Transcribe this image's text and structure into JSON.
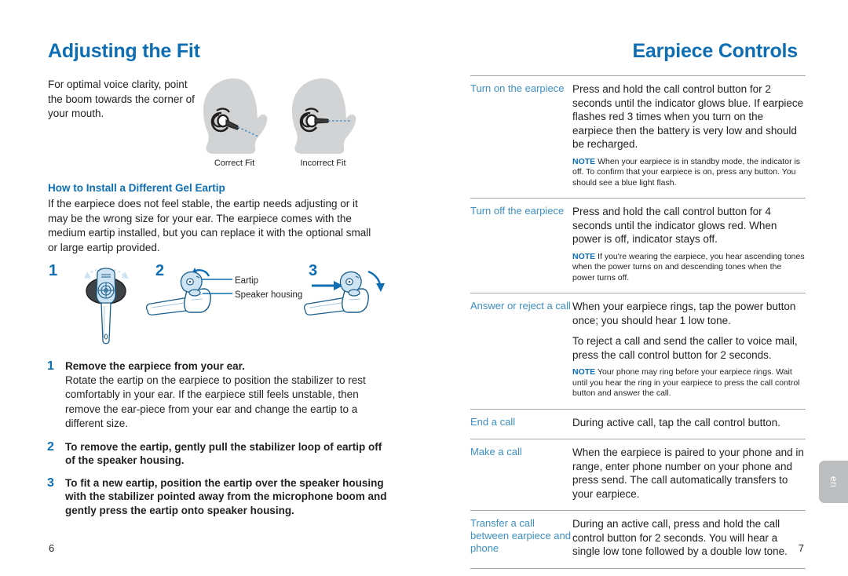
{
  "document": {
    "language_tab": "en"
  },
  "left_page": {
    "title": "Adjusting the Fit",
    "folio": "6",
    "intro": "For optimal voice clarity, point the boom towards the corner of your mouth.",
    "figures": [
      {
        "caption": "Correct Fit",
        "icon": "head-with-earpiece-correct-icon"
      },
      {
        "caption": "Incorrect Fit",
        "icon": "head-with-earpiece-incorrect-icon"
      }
    ],
    "subhead": "How to Install a Different Gel Eartip",
    "paragraph": "If the earpiece does not feel stable, the eartip needs adjusting or it may be the wrong size for your ear. The earpiece comes with the medium eartip installed, but you can replace it with the optional small or large eartip provided.",
    "figure_steps": [
      {
        "number": "1"
      },
      {
        "number": "2"
      },
      {
        "number": "3"
      }
    ],
    "figure_callouts": [
      "Eartip",
      "Speaker housing"
    ],
    "instructions": [
      {
        "number": "1",
        "lead": "Remove the earpiece from your ear.",
        "detail": "Rotate the eartip on the earpiece to position the stabilizer to rest comfortably in your ear. If the earpiece still feels unstable, then remove the ear-piece from your ear and change the eartip to a different size."
      },
      {
        "number": "2",
        "lead": "To remove the eartip, gently pull the stabilizer loop of eartip off of the speaker housing.",
        "detail": ""
      },
      {
        "number": "3",
        "lead": "To fit a new eartip, position the eartip over the speaker housing with the stabilizer pointed away from the microphone boom and gently press the eartip onto speaker housing.",
        "detail": ""
      }
    ]
  },
  "right_page": {
    "title": "Earpiece Controls",
    "folio": "7",
    "rows": [
      {
        "label": "Turn on the earpiece",
        "paragraphs": [
          "Press and hold the call control button for 2 seconds until the indicator glows blue. If earpiece flashes red 3 times when you turn on the earpiece then the battery is very low and should be recharged."
        ],
        "note_keyword": "NOTE",
        "note": "When your earpiece is in standby mode, the indicator is off. To confirm that your earpiece is on, press any button. You should see a blue light flash."
      },
      {
        "label": "Turn off the earpiece",
        "paragraphs": [
          "Press and hold the call control button for 4 seconds until the indicator glows red. When power is off, indicator stays off."
        ],
        "note_keyword": "NOTE",
        "note": "If you're wearing the earpiece, you hear ascending tones when the power turns on and descending tones when the power turns off."
      },
      {
        "label": "Answer or reject a call",
        "paragraphs": [
          "When your earpiece rings, tap the power button once; you should hear 1 low tone.",
          "To reject a call and send the caller to voice mail, press the call control button for 2 seconds."
        ],
        "note_keyword": "NOTE",
        "note": "Your phone may ring before your earpiece rings. Wait until you hear the ring in your earpiece to press the call control button and answer the call."
      },
      {
        "label": "End a call",
        "paragraphs": [
          "During active call, tap the call control button."
        ],
        "note_keyword": "",
        "note": ""
      },
      {
        "label": "Make a call",
        "paragraphs": [
          "When the earpiece is paired to your phone and in range, enter phone number on your phone and press send. The call automatically transfers to your earpiece."
        ],
        "note_keyword": "",
        "note": ""
      },
      {
        "label": "Transfer a call between earpiece and phone",
        "paragraphs": [
          "During an active call, press and hold the call control button for 2 seconds. You will hear a single low tone followed by a double low tone."
        ],
        "note_keyword": "",
        "note": ""
      }
    ]
  },
  "colors": {
    "heading_blue": "#0d6eb4",
    "label_blue": "#3d8fc4",
    "rule_gray": "#a7a9ac",
    "silhouette_gray": "#d1d3d4",
    "body_text": "#231f20",
    "tab_gray": "#bcbec0"
  }
}
